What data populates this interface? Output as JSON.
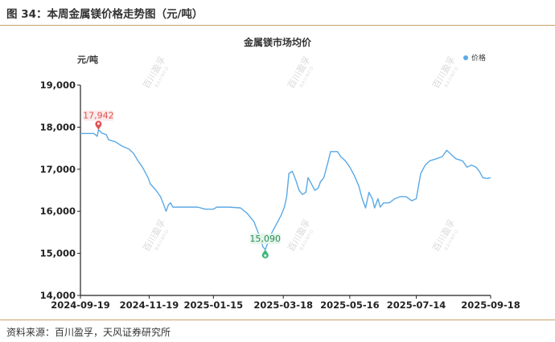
{
  "figure": {
    "title": "图 34：本周金属镁价格走势图（元/吨）",
    "source": "资料来源：百川盈孚，天风证券研究所"
  },
  "watermark": {
    "text": "百川盈孚",
    "subtext": "BAIINFO"
  },
  "colors": {
    "line": "#5aa9e6",
    "max_marker": "#e05050",
    "min_marker": "#3cb878",
    "axis": "#222222",
    "rule": "#c8a36a"
  },
  "chart_data": {
    "type": "line",
    "title": "金属镁市场均价",
    "ylabel": "元/吨",
    "ylim": [
      14000,
      19000
    ],
    "yticks": [
      "14,000",
      "15,000",
      "16,000",
      "17,000",
      "18,000",
      "19,000"
    ],
    "ytick_values": [
      14000,
      15000,
      16000,
      17000,
      18000,
      19000
    ],
    "xticks": [
      "2024-09-19",
      "2024-11-19",
      "2025-01-15",
      "2025-03-18",
      "2025-05-16",
      "2025-07-14",
      "2025-09-18"
    ],
    "xlim": [
      "2024-09-19",
      "2025-09-18"
    ],
    "legend": "top-right",
    "series": [
      {
        "name": "价格",
        "points": [
          [
            "2024-09-19",
            17850
          ],
          [
            "2024-10-01",
            17850
          ],
          [
            "2024-10-04",
            17780
          ],
          [
            "2024-10-05",
            17942
          ],
          [
            "2024-10-08",
            17860
          ],
          [
            "2024-10-12",
            17820
          ],
          [
            "2024-10-14",
            17700
          ],
          [
            "2024-10-20",
            17650
          ],
          [
            "2024-10-26",
            17550
          ],
          [
            "2024-11-01",
            17480
          ],
          [
            "2024-11-05",
            17380
          ],
          [
            "2024-11-09",
            17200
          ],
          [
            "2024-11-13",
            17050
          ],
          [
            "2024-11-18",
            16800
          ],
          [
            "2024-11-20",
            16650
          ],
          [
            "2024-11-25",
            16500
          ],
          [
            "2024-11-29",
            16350
          ],
          [
            "2024-12-02",
            16150
          ],
          [
            "2024-12-04",
            16000
          ],
          [
            "2024-12-06",
            16150
          ],
          [
            "2024-12-08",
            16200
          ],
          [
            "2024-12-10",
            16100
          ],
          [
            "2024-12-20",
            16100
          ],
          [
            "2025-01-01",
            16100
          ],
          [
            "2025-01-08",
            16050
          ],
          [
            "2025-01-15",
            16050
          ],
          [
            "2025-01-18",
            16100
          ],
          [
            "2025-01-28",
            16100
          ],
          [
            "2025-02-08",
            16080
          ],
          [
            "2025-02-14",
            15950
          ],
          [
            "2025-02-20",
            15750
          ],
          [
            "2025-02-25",
            15400
          ],
          [
            "2025-02-28",
            15150
          ],
          [
            "2025-03-02",
            15090
          ],
          [
            "2025-03-05",
            15300
          ],
          [
            "2025-03-08",
            15500
          ],
          [
            "2025-03-12",
            15700
          ],
          [
            "2025-03-16",
            15900
          ],
          [
            "2025-03-19",
            16100
          ],
          [
            "2025-03-21",
            16350
          ],
          [
            "2025-03-23",
            16900
          ],
          [
            "2025-03-26",
            16950
          ],
          [
            "2025-03-29",
            16750
          ],
          [
            "2025-04-01",
            16500
          ],
          [
            "2025-04-04",
            16400
          ],
          [
            "2025-04-07",
            16450
          ],
          [
            "2025-04-09",
            16800
          ],
          [
            "2025-04-12",
            16650
          ],
          [
            "2025-04-15",
            16500
          ],
          [
            "2025-04-18",
            16550
          ],
          [
            "2025-04-20",
            16700
          ],
          [
            "2025-04-23",
            16800
          ],
          [
            "2025-04-27",
            17200
          ],
          [
            "2025-04-29",
            17420
          ],
          [
            "2025-05-05",
            17420
          ],
          [
            "2025-05-08",
            17300
          ],
          [
            "2025-05-12",
            17200
          ],
          [
            "2025-05-16",
            17050
          ],
          [
            "2025-05-20",
            16850
          ],
          [
            "2025-05-24",
            16600
          ],
          [
            "2025-05-27",
            16300
          ],
          [
            "2025-05-30",
            16080
          ],
          [
            "2025-06-02",
            16450
          ],
          [
            "2025-06-05",
            16300
          ],
          [
            "2025-06-07",
            16080
          ],
          [
            "2025-06-10",
            16300
          ],
          [
            "2025-06-12",
            16100
          ],
          [
            "2025-06-15",
            16200
          ],
          [
            "2025-06-20",
            16200
          ],
          [
            "2025-06-25",
            16300
          ],
          [
            "2025-06-30",
            16350
          ],
          [
            "2025-07-05",
            16350
          ],
          [
            "2025-07-10",
            16250
          ],
          [
            "2025-07-14",
            16300
          ],
          [
            "2025-07-18",
            16900
          ],
          [
            "2025-07-22",
            17100
          ],
          [
            "2025-07-26",
            17200
          ],
          [
            "2025-08-01",
            17250
          ],
          [
            "2025-08-06",
            17300
          ],
          [
            "2025-08-10",
            17450
          ],
          [
            "2025-08-14",
            17350
          ],
          [
            "2025-08-18",
            17250
          ],
          [
            "2025-08-24",
            17200
          ],
          [
            "2025-08-28",
            17050
          ],
          [
            "2025-09-01",
            17100
          ],
          [
            "2025-09-05",
            17050
          ],
          [
            "2025-09-08",
            16950
          ],
          [
            "2025-09-11",
            16800
          ],
          [
            "2025-09-15",
            16780
          ],
          [
            "2025-09-18",
            16800
          ]
        ]
      }
    ],
    "annotations": [
      {
        "type": "max",
        "date": "2024-10-05",
        "value": 17942,
        "label": "17,942"
      },
      {
        "type": "min",
        "date": "2025-03-02",
        "value": 15090,
        "label": "15,090"
      }
    ]
  }
}
